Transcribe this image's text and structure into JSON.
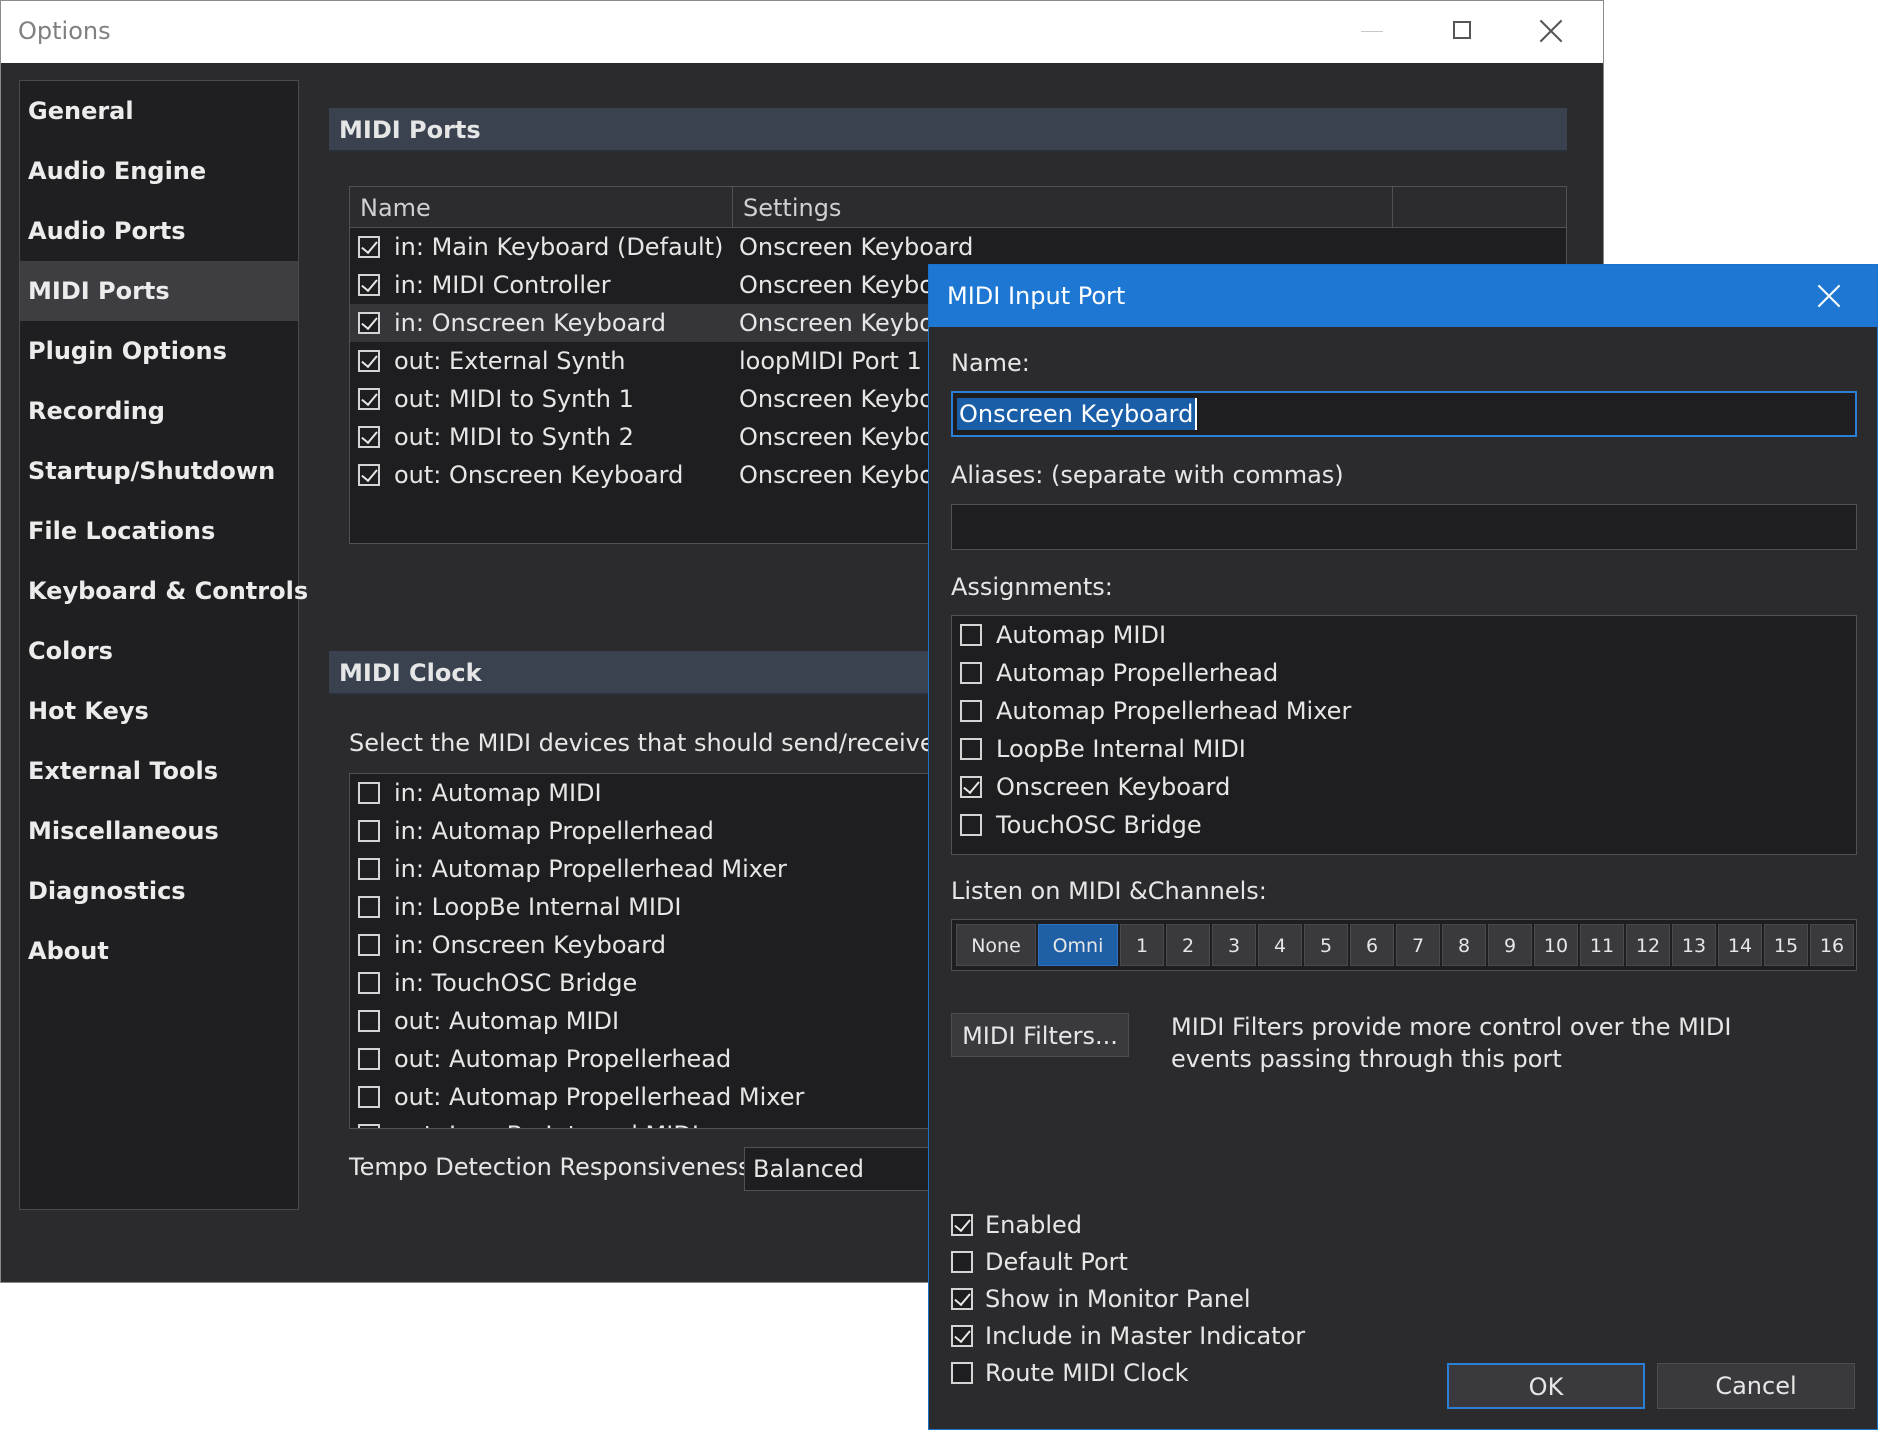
{
  "options": {
    "title": "Options",
    "sidebar": [
      "General",
      "Audio Engine",
      "Audio Ports",
      "MIDI Ports",
      "Plugin Options",
      "Recording",
      "Startup/Shutdown",
      "File Locations",
      "Keyboard & Controls",
      "Colors",
      "Hot Keys",
      "External Tools",
      "Miscellaneous",
      "Diagnostics",
      "About"
    ],
    "active_item": "MIDI Ports",
    "ports_section_title": "MIDI Ports",
    "ports_columns": {
      "name": "Name",
      "settings": "Settings"
    },
    "ports": [
      {
        "name": "in: Main Keyboard (Default)",
        "settings": "Onscreen Keyboard",
        "checked": true
      },
      {
        "name": "in: MIDI Controller",
        "settings": "Onscreen Keyboa",
        "checked": true
      },
      {
        "name": "in: Onscreen Keyboard",
        "settings": "Onscreen Keyboa",
        "checked": true,
        "selected": true
      },
      {
        "name": "out: External Synth",
        "settings": "loopMIDI Port 1",
        "checked": true
      },
      {
        "name": "out: MIDI to Synth 1",
        "settings": "Onscreen Keyboa",
        "checked": true
      },
      {
        "name": "out: MIDI to Synth 2",
        "settings": "Onscreen Keyboa",
        "checked": true
      },
      {
        "name": "out: Onscreen Keyboard",
        "settings": "Onscreen Keyboa",
        "checked": true
      }
    ],
    "clock_section_title": "MIDI Clock",
    "clock_description": "Select the MIDI devices that should send/receive MID",
    "clock_devices": [
      "in: Automap MIDI",
      "in: Automap Propellerhead",
      "in: Automap Propellerhead Mixer",
      "in: LoopBe Internal MIDI",
      "in: Onscreen Keyboard",
      "in: TouchOSC Bridge",
      "out: Automap MIDI",
      "out: Automap Propellerhead",
      "out: Automap Propellerhead Mixer",
      "out: LoopBe Internal MIDI"
    ],
    "tempo_label": "Tempo Detection Responsiveness:",
    "tempo_value": "Balanced"
  },
  "dialog": {
    "title": "MIDI Input Port",
    "name_label": "Name:",
    "name_value": "Onscreen Keyboard",
    "aliases_label": "Aliases: (separate with commas)",
    "aliases_value": "",
    "assignments_label": "Assignments:",
    "assignments": [
      {
        "name": "Automap MIDI",
        "checked": false
      },
      {
        "name": "Automap Propellerhead",
        "checked": false
      },
      {
        "name": "Automap Propellerhead Mixer",
        "checked": false
      },
      {
        "name": "LoopBe Internal MIDI",
        "checked": false
      },
      {
        "name": "Onscreen Keyboard",
        "checked": true
      },
      {
        "name": "TouchOSC Bridge",
        "checked": false
      }
    ],
    "channels_label": "Listen on MIDI &Channels:",
    "channels": [
      "None",
      "Omni",
      "1",
      "2",
      "3",
      "4",
      "5",
      "6",
      "7",
      "8",
      "9",
      "10",
      "11",
      "12",
      "13",
      "14",
      "15",
      "16"
    ],
    "active_channel": "Omni",
    "filters_button": "MIDI Filters...",
    "filters_description": "MIDI Filters provide more control over the MIDI events passing through this port",
    "options": [
      {
        "label": "Enabled",
        "checked": true
      },
      {
        "label": "Default Port",
        "checked": false
      },
      {
        "label": "Show in Monitor Panel",
        "checked": true
      },
      {
        "label": "Include in Master Indicator",
        "checked": true
      },
      {
        "label": "Route MIDI Clock",
        "checked": false
      }
    ],
    "ok_label": "OK",
    "cancel_label": "Cancel"
  },
  "colors": {
    "accent": "#1e77d3",
    "window_bg": "#2b2b2e",
    "section_header": "#3a4250",
    "list_bg": "#1e1e20"
  }
}
